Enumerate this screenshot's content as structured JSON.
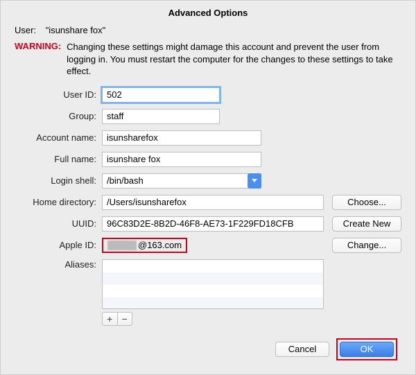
{
  "title": "Advanced Options",
  "user": {
    "label": "User:",
    "value": "\"isunshare fox\""
  },
  "warning": {
    "label": "WARNING:",
    "text": "Changing these settings might damage this account and prevent the user from logging in. You must restart the computer for the changes to these settings to take effect."
  },
  "labels": {
    "user_id": "User ID:",
    "group": "Group:",
    "account_name": "Account name:",
    "full_name": "Full name:",
    "login_shell": "Login shell:",
    "home_directory": "Home directory:",
    "uuid": "UUID:",
    "apple_id": "Apple ID:",
    "aliases": "Aliases:"
  },
  "values": {
    "user_id": "502",
    "group": "staff",
    "account_name": "isunsharefox",
    "full_name": "isunshare fox",
    "login_shell": "/bin/bash",
    "home_directory": "/Users/isunsharefox",
    "uuid": "96C83D2E-8B2D-46F8-AE73-1F229FD18CFB",
    "apple_id_visible": "@163.com"
  },
  "buttons": {
    "choose": "Choose...",
    "create_new": "Create New",
    "change": "Change...",
    "cancel": "Cancel",
    "ok": "OK",
    "plus": "+",
    "minus": "−"
  }
}
